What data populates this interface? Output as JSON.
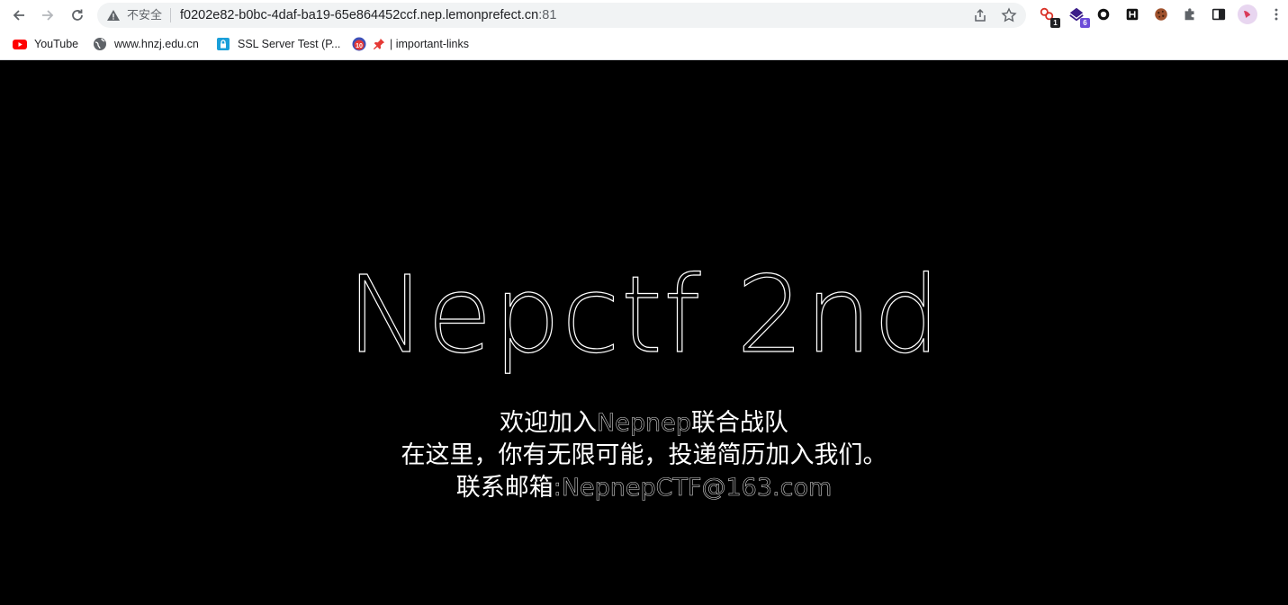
{
  "browser": {
    "security_label": "不安全",
    "url_host": "f0202e82-b0bc-4daf-ba19-65e864452ccf.nep.lemonprefect.cn",
    "url_port": ":81",
    "extensions": [
      {
        "name": "ext-1",
        "badge": "1"
      },
      {
        "name": "ext-2",
        "badge": "6"
      }
    ]
  },
  "bookmarks": [
    {
      "label": "YouTube"
    },
    {
      "label": "www.hnzj.edu.cn"
    },
    {
      "label": "SSL Server Test (P..."
    },
    {
      "label": "| important-links"
    }
  ],
  "page": {
    "title": "Nepctf 2nd",
    "line1_a": "欢迎加入",
    "line1_b": "Nepnep",
    "line1_c": "联合战队",
    "line2": "在这里，你有无限可能，投递简历加入我们。",
    "line3_label": "联系邮箱",
    "line3_colon": ":",
    "line3_email": "NepnepCTF@163.com"
  }
}
